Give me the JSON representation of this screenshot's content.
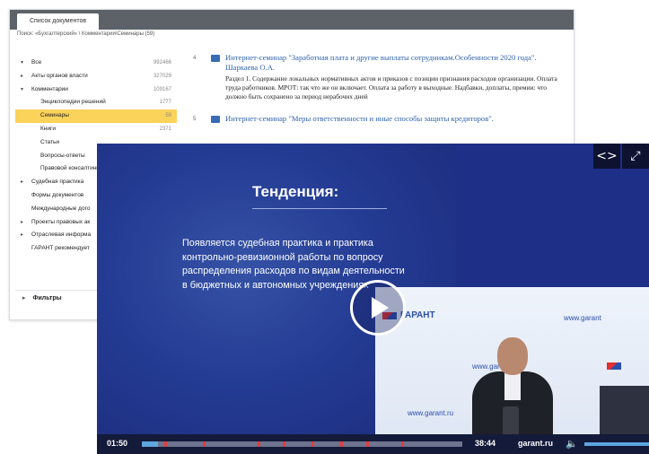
{
  "doc_window": {
    "tab_label": "Список документов",
    "breadcrumb": "Поиск: «Бухгалтерский» \\ Комментарии\\Семинары (59)",
    "tree": [
      {
        "label": "Все",
        "count": "992466",
        "arrow": "▾",
        "indent": 0
      },
      {
        "label": "Акты органов власти",
        "count": "327029",
        "arrow": "▸",
        "indent": 0
      },
      {
        "label": "Комментарии",
        "count": "109167",
        "arrow": "▾",
        "indent": 0
      },
      {
        "label": "Энциклопедии решений",
        "count": "1777",
        "arrow": "",
        "indent": 1
      },
      {
        "label": "Семинары",
        "count": "59",
        "arrow": "",
        "indent": 1,
        "selected": true
      },
      {
        "label": "Книги",
        "count": "2371",
        "arrow": "",
        "indent": 1
      },
      {
        "label": "Статьи",
        "count": "",
        "arrow": "",
        "indent": 1
      },
      {
        "label": "Вопросы-ответы",
        "count": "",
        "arrow": "",
        "indent": 1
      },
      {
        "label": "Правовой консалтинг",
        "count": "",
        "arrow": "",
        "indent": 1
      },
      {
        "label": "Судебная практика",
        "count": "",
        "arrow": "▸",
        "indent": 0
      },
      {
        "label": "Формы документов",
        "count": "",
        "arrow": "",
        "indent": 0
      },
      {
        "label": "Международные дого",
        "count": "",
        "arrow": "",
        "indent": 0
      },
      {
        "label": "Проекты правовых ак",
        "count": "",
        "arrow": "▸",
        "indent": 0
      },
      {
        "label": "Отраслевая информа",
        "count": "",
        "arrow": "▸",
        "indent": 0
      },
      {
        "label": "ГАРАНТ рекомендует",
        "count": "",
        "arrow": "",
        "indent": 0
      }
    ],
    "filters_label": "Фильтры",
    "results": [
      {
        "num": "4",
        "title": "Интернет-семинар \"Заработная плата и другие выплаты сотрудникам.Особенности 2020 года\". Шаркаева О.А.",
        "snippet": "Раздел 1. Содержание локальных нормативных актов и приказов с позиции признания расходов организации. Оплата труда работников. МРОТ: так что же он включает. Оплата за работу в выходные. Надбавки, доплаты, премии: что должно быть сохранено за период нерабочих дней"
      },
      {
        "num": "5",
        "title": "Интернет-семинар \"Меры ответственности и иные способы защиты кредиторов\".",
        "snippet": ""
      }
    ]
  },
  "video": {
    "slide_heading": "Тенденция:",
    "slide_body": "Появляется судебная практика и практика контрольно-ревизионной работы по вопросу распределения расходов по видам деятельности в бюджетных и автономных учреждениях",
    "studio_logo": "ГАРАНТ",
    "studio_url": "www.garant.ru",
    "studio_url_short": "www.garant",
    "current_time": "01:50",
    "duration": "38:44",
    "brand": "garant.ru",
    "progress_fraction": 0.05,
    "markers": [
      0.07,
      0.19,
      0.36,
      0.44,
      0.53,
      0.62,
      0.7,
      0.81
    ],
    "icons": {
      "embed": "code-icon",
      "fullscreen": "expand-icon",
      "volume": "speaker-icon",
      "play": "play-icon"
    },
    "colors": {
      "slide_bg": "#243b93",
      "progress_played": "#5ea6e0",
      "marker": "#e53b3b",
      "selected_row": "#fbd25a",
      "link": "#2f64ad"
    }
  }
}
